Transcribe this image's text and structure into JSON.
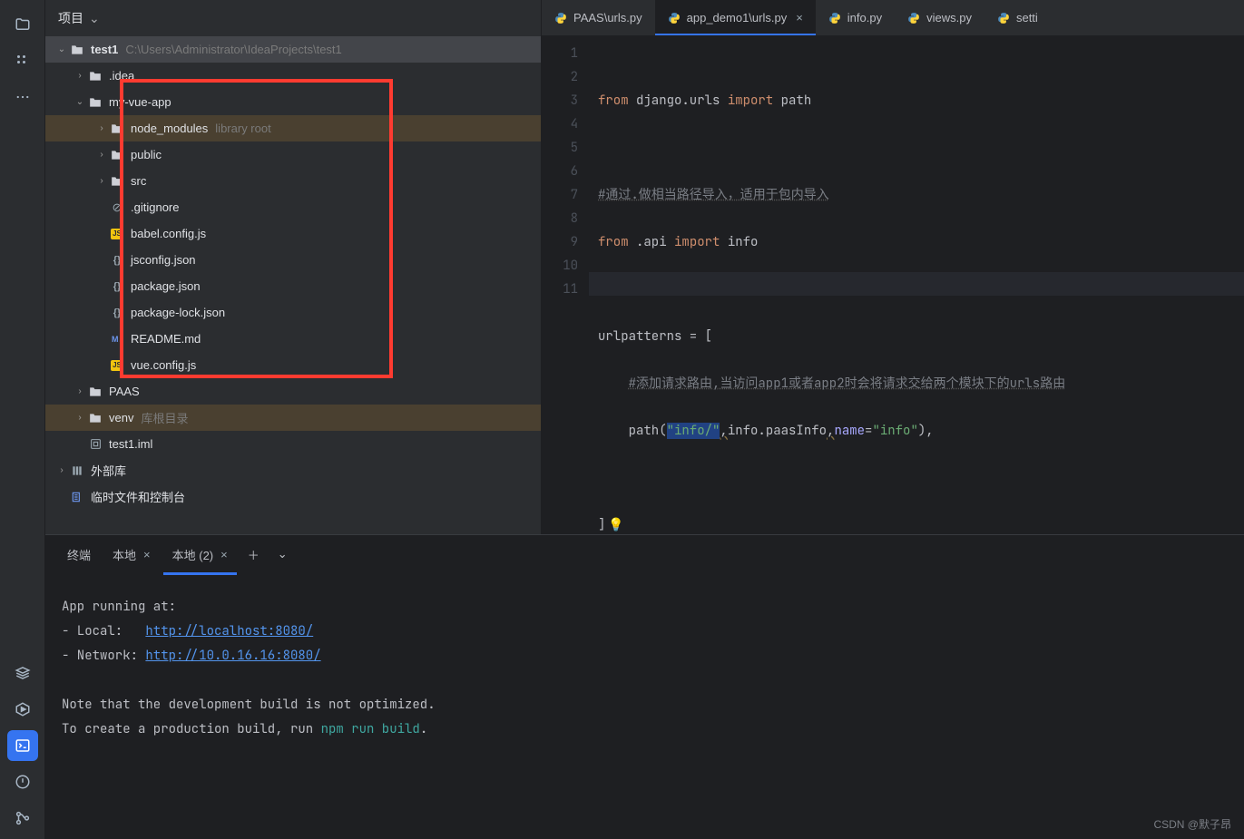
{
  "sidebar": {
    "title": "项目",
    "root": {
      "name": "test1",
      "path": "C:\\Users\\Administrator\\IdeaProjects\\test1"
    },
    "items": [
      {
        "label": ".idea"
      },
      {
        "label": "my-vue-app"
      },
      {
        "label": "node_modules",
        "suffix": "library root"
      },
      {
        "label": "public"
      },
      {
        "label": "src"
      },
      {
        "label": ".gitignore"
      },
      {
        "label": "babel.config.js"
      },
      {
        "label": "jsconfig.json"
      },
      {
        "label": "package.json"
      },
      {
        "label": "package-lock.json"
      },
      {
        "label": "README.md"
      },
      {
        "label": "vue.config.js"
      },
      {
        "label": "PAAS"
      },
      {
        "label": "venv",
        "suffix": "库根目录"
      },
      {
        "label": "test1.iml"
      },
      {
        "label": "外部库"
      },
      {
        "label": "临时文件和控制台"
      }
    ]
  },
  "editor": {
    "tabs": [
      {
        "label": "PAAS\\urls.py"
      },
      {
        "label": "app_demo1\\urls.py"
      },
      {
        "label": "info.py"
      },
      {
        "label": "views.py"
      },
      {
        "label": "setti"
      }
    ],
    "lines": [
      "1",
      "2",
      "3",
      "4",
      "5",
      "6",
      "7",
      "8",
      "9",
      "10",
      "11"
    ],
    "code": {
      "l1_from": "from",
      "l1_mod": " django.urls ",
      "l1_import": "import",
      "l1_name": " path",
      "l3_cmt": "#通过.做相当路径导入，适用于包内导入",
      "l4_from": "from",
      "l4_mod": " .api ",
      "l4_import": "import",
      "l4_name": " info",
      "l6": "urlpatterns = [",
      "l7_cmt": "#添加请求路由,当访问app1或者app2时会将请求交给两个模块下的urls路由",
      "l8_path": "    path(",
      "l8_str": "\"info/\"",
      "l8_comma1": ",",
      "l8_info": "info.paasInfo",
      "l8_comma2": ",",
      "l8_name": "name",
      "l8_eq": "=",
      "l8_str2": "\"info\"",
      "l8_close": "),",
      "l10": "]"
    }
  },
  "terminal": {
    "title": "终端",
    "tabs": [
      {
        "label": "本地"
      },
      {
        "label": "本地 (2)"
      }
    ],
    "out": {
      "l1": "App running at:",
      "l2a": "- Local:   ",
      "l2url": "http://localhost:8080/",
      "l3a": "- Network: ",
      "l3url": "http://10.0.16.16:8080/",
      "l5": "Note that the development build is not optimized.",
      "l6a": "To create a production build, run ",
      "l6npm": "npm run build",
      "l6b": "."
    }
  },
  "watermark": "CSDN @默子昂"
}
